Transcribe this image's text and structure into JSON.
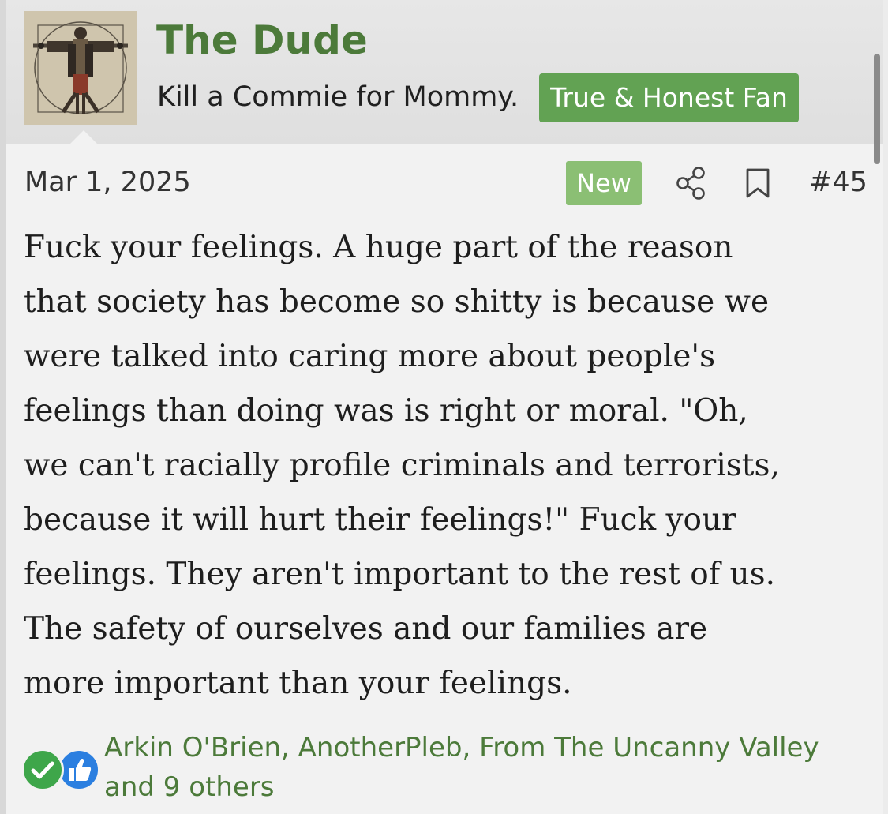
{
  "user": {
    "name": "The Dude",
    "title": "Kill a Commie for Mommy.",
    "banner": "True & Honest Fan"
  },
  "post": {
    "date": "Mar 1, 2025",
    "new_badge": "New",
    "number": "#45",
    "lines": [
      "Fuck your feelings. A huge part of the reason",
      "that society has become so shitty is because we",
      "were talked into caring more about people's",
      "feelings than doing was is right or moral. \"Oh,",
      "we can't racially profile criminals and terrorists,",
      "because it will hurt their feelings!\" Fuck your",
      "feelings. They aren't important to the rest of us.",
      "The safety of ourselves and our families are",
      "more important than your feelings."
    ]
  },
  "reactions": {
    "icons": [
      "check-icon",
      "like-icon"
    ],
    "users_line1": "Arkin O'Brien, AnotherPleb, From The Uncanny Valley",
    "users_line2": "and 9 others"
  },
  "colors": {
    "username": "#4c7a3a",
    "banner_bg": "#62a253",
    "new_badge_bg": "#8bbf74",
    "like": "#2b7fe0",
    "check": "#3ea64a"
  },
  "icons": {
    "share": "share-icon",
    "bookmark": "bookmark-icon"
  }
}
